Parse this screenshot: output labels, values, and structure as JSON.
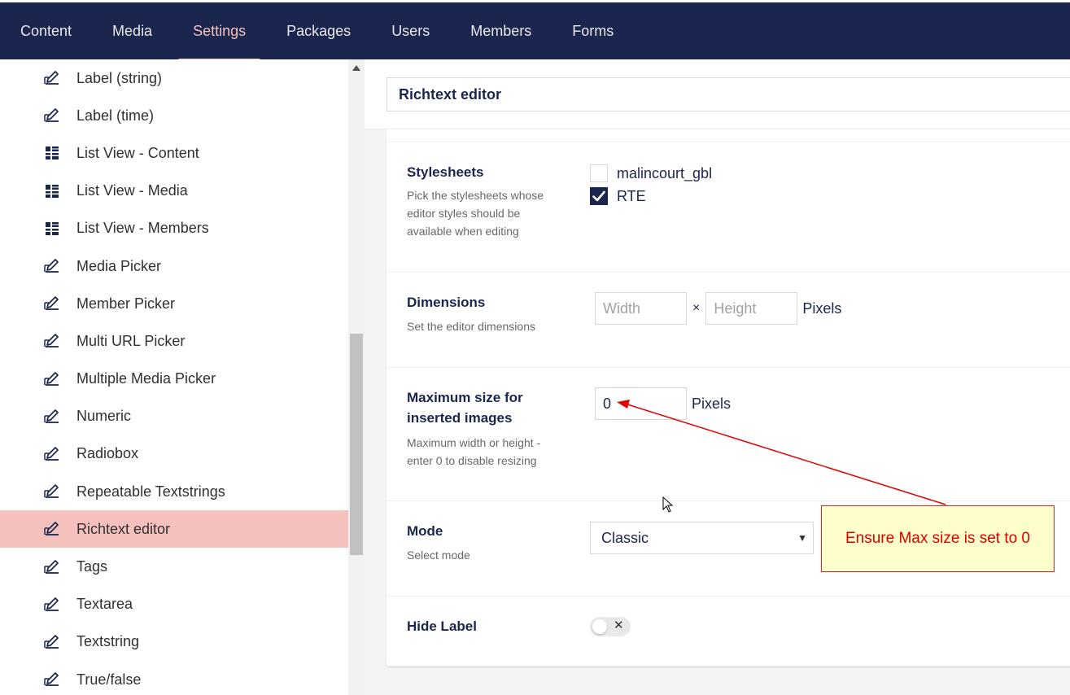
{
  "nav": {
    "items": [
      {
        "label": "Content"
      },
      {
        "label": "Media"
      },
      {
        "label": "Settings"
      },
      {
        "label": "Packages"
      },
      {
        "label": "Users"
      },
      {
        "label": "Members"
      },
      {
        "label": "Forms"
      }
    ],
    "active": "Settings"
  },
  "tree": {
    "items": [
      {
        "label": "Label (string)",
        "icon": "pencil-icon"
      },
      {
        "label": "Label (time)",
        "icon": "pencil-icon"
      },
      {
        "label": "List View - Content",
        "icon": "list-icon"
      },
      {
        "label": "List View - Media",
        "icon": "list-icon"
      },
      {
        "label": "List View - Members",
        "icon": "list-icon"
      },
      {
        "label": "Media Picker",
        "icon": "pencil-icon"
      },
      {
        "label": "Member Picker",
        "icon": "pencil-icon"
      },
      {
        "label": "Multi URL Picker",
        "icon": "pencil-icon"
      },
      {
        "label": "Multiple Media Picker",
        "icon": "pencil-icon"
      },
      {
        "label": "Numeric",
        "icon": "pencil-icon"
      },
      {
        "label": "Radiobox",
        "icon": "pencil-icon"
      },
      {
        "label": "Repeatable Textstrings",
        "icon": "pencil-icon"
      },
      {
        "label": "Richtext editor",
        "icon": "pencil-icon",
        "selected": true
      },
      {
        "label": "Tags",
        "icon": "pencil-icon"
      },
      {
        "label": "Textarea",
        "icon": "pencil-icon"
      },
      {
        "label": "Textstring",
        "icon": "pencil-icon"
      },
      {
        "label": "True/false",
        "icon": "pencil-icon"
      }
    ]
  },
  "editor": {
    "name": "Richtext editor",
    "stylesheets": {
      "title": "Stylesheets",
      "description": "Pick the stylesheets whose editor styles should be available when editing",
      "options": [
        {
          "label": "malincourt_gbl",
          "checked": false
        },
        {
          "label": "RTE",
          "checked": true
        }
      ]
    },
    "dimensions": {
      "title": "Dimensions",
      "description": "Set the editor dimensions",
      "width_placeholder": "Width",
      "height_placeholder": "Height",
      "separator": "×",
      "unit": "Pixels"
    },
    "max_size": {
      "title": "Maximum size for inserted images",
      "description": "Maximum width or height - enter 0 to disable resizing",
      "value": "0",
      "unit": "Pixels"
    },
    "mode": {
      "title": "Mode",
      "description": "Select mode",
      "selected": "Classic"
    },
    "hide_label": {
      "title": "Hide Label",
      "on": false
    }
  },
  "annotation": {
    "text": "Ensure Max size is set to 0",
    "color": "#e00000"
  },
  "colors": {
    "nav_bg": "#1b264f",
    "accent": "#f5c1bc",
    "selected_row": "#f5c1bc"
  }
}
